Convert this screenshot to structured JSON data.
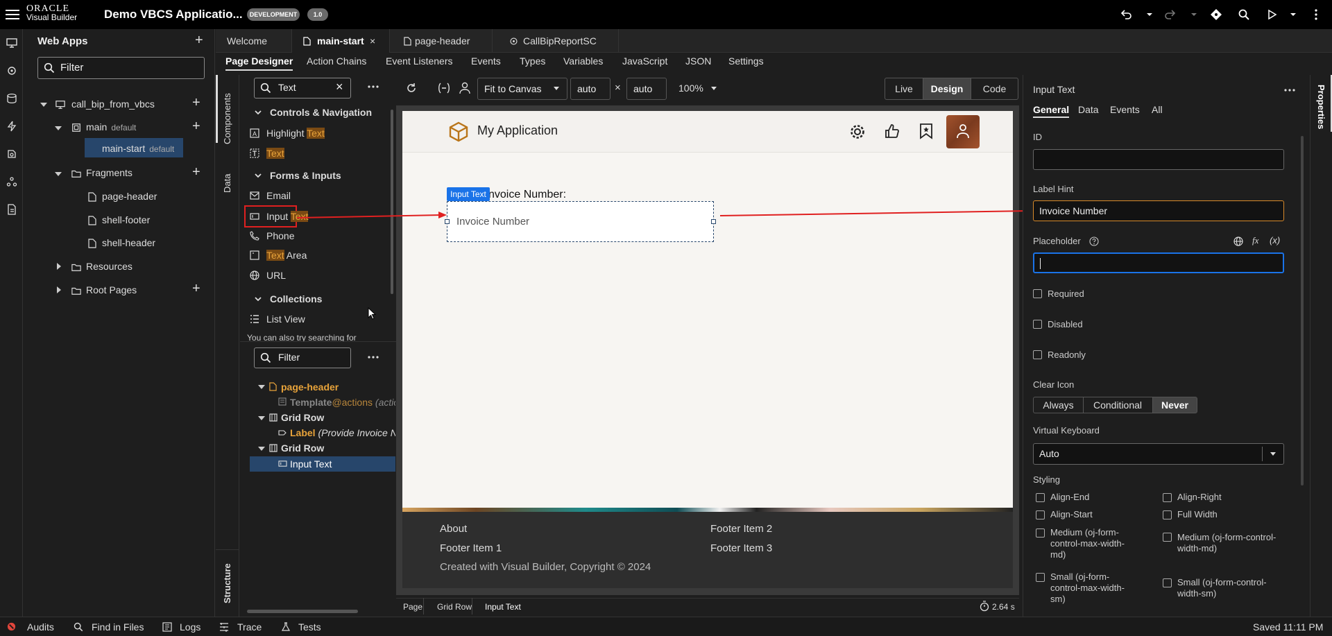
{
  "topbar": {
    "logo_oracle": "ORACLE",
    "logo_vb": "Visual Builder",
    "app_title": "Demo VBCS Applicatio...",
    "env_badge": "DEVELOPMENT",
    "version_badge": "1.0"
  },
  "webapps": {
    "title": "Web Apps",
    "filter_placeholder": "Filter",
    "tree": {
      "app": "call_bip_from_vbcs",
      "main": "main",
      "main_default": "default",
      "main_start": "main-start",
      "main_start_default": "default",
      "fragments": "Fragments",
      "page_header": "page-header",
      "shell_footer": "shell-footer",
      "shell_header": "shell-header",
      "resources": "Resources",
      "root_pages": "Root Pages"
    }
  },
  "tabs": [
    "Welcome",
    "main-start",
    "page-header",
    "CallBipReportSC"
  ],
  "subtabs": [
    "Page Designer",
    "Action Chains",
    "Event Listeners",
    "Events",
    "Types",
    "Variables",
    "JavaScript",
    "JSON",
    "Settings"
  ],
  "components": {
    "vtab_components": "Components",
    "vtab_data": "Data",
    "vtab_structure": "Structure",
    "search_value": "Text",
    "sections": {
      "controls": "Controls & Navigation",
      "forms": "Forms & Inputs",
      "collections": "Collections"
    },
    "items": {
      "highlight": "Highlight ",
      "highlight_hl": "Text",
      "text_hl": "Text",
      "email": "Email",
      "input": "Input ",
      "input_hl": "Text",
      "phone": "Phone",
      "textarea_hl": "Text",
      "textarea": " Area",
      "url": "URL",
      "listview": "List View"
    },
    "hint": "You can also try searching for"
  },
  "structure": {
    "filter_placeholder": "Filter",
    "page_header": "page-header",
    "template": "Template",
    "template_suffix": "@actions",
    "template_paren": "(actio",
    "grid_row_1": "Grid Row",
    "label": "Label",
    "label_paren": "(Provide Invoice Nu",
    "grid_row_2": "Grid Row",
    "input_text": "Input Text"
  },
  "toolbar": {
    "fit_to_canvas": "Fit to Canvas",
    "width": "auto",
    "times": "×",
    "height": "auto",
    "zoom": "100%",
    "live": "Live",
    "design": "Design",
    "code": "Code"
  },
  "canvas": {
    "app_name": "My Application",
    "selected_tag": "Input Text",
    "label_text": "nvoice Number:",
    "input_value": "Invoice Number",
    "footer": {
      "about": "About",
      "item1": "Footer Item 1",
      "item2": "Footer Item 2",
      "item3": "Footer Item 3",
      "copyright": "Created with Visual Builder, Copyright © 2024"
    }
  },
  "breadcrumb": [
    "Page",
    "Grid Row",
    "Input Text"
  ],
  "timing": "2.64 s",
  "properties": {
    "vtab": "Properties",
    "title": "Input Text",
    "tabs": [
      "General",
      "Data",
      "Events",
      "All"
    ],
    "id_label": "ID",
    "id_value": "",
    "label_hint_label": "Label Hint",
    "label_hint_value": "Invoice Number",
    "placeholder_label": "Placeholder",
    "placeholder_value": "",
    "fx": "fx",
    "x_var": "(x)",
    "required": "Required",
    "disabled": "Disabled",
    "readonly": "Readonly",
    "clear_icon_label": "Clear Icon",
    "clear_options": [
      "Always",
      "Conditional",
      "Never"
    ],
    "clear_selected": "Never",
    "virtual_keyboard_label": "Virtual Keyboard",
    "virtual_keyboard_value": "Auto",
    "styling_label": "Styling",
    "styling": {
      "align_end": "Align-End",
      "align_right": "Align-Right",
      "align_start": "Align-Start",
      "full_width": "Full Width",
      "medium_max": "Medium (oj-form-control-max-width-md)",
      "medium": "Medium (oj-form-control-width-md)",
      "small_max": "Small (oj-form-control-max-width-sm)",
      "small": "Small (oj-form-control-width-sm)"
    }
  },
  "statusbar": {
    "audits": "Audits",
    "find": "Find in Files",
    "logs": "Logs",
    "trace": "Trace",
    "tests": "Tests",
    "saved": "Saved 11:11 PM"
  },
  "colors": {
    "accent_blue": "#1a73e8",
    "highlight_orange": "#7a4a13",
    "annotation_red": "#e02020",
    "selected_tree": "#27466b"
  }
}
